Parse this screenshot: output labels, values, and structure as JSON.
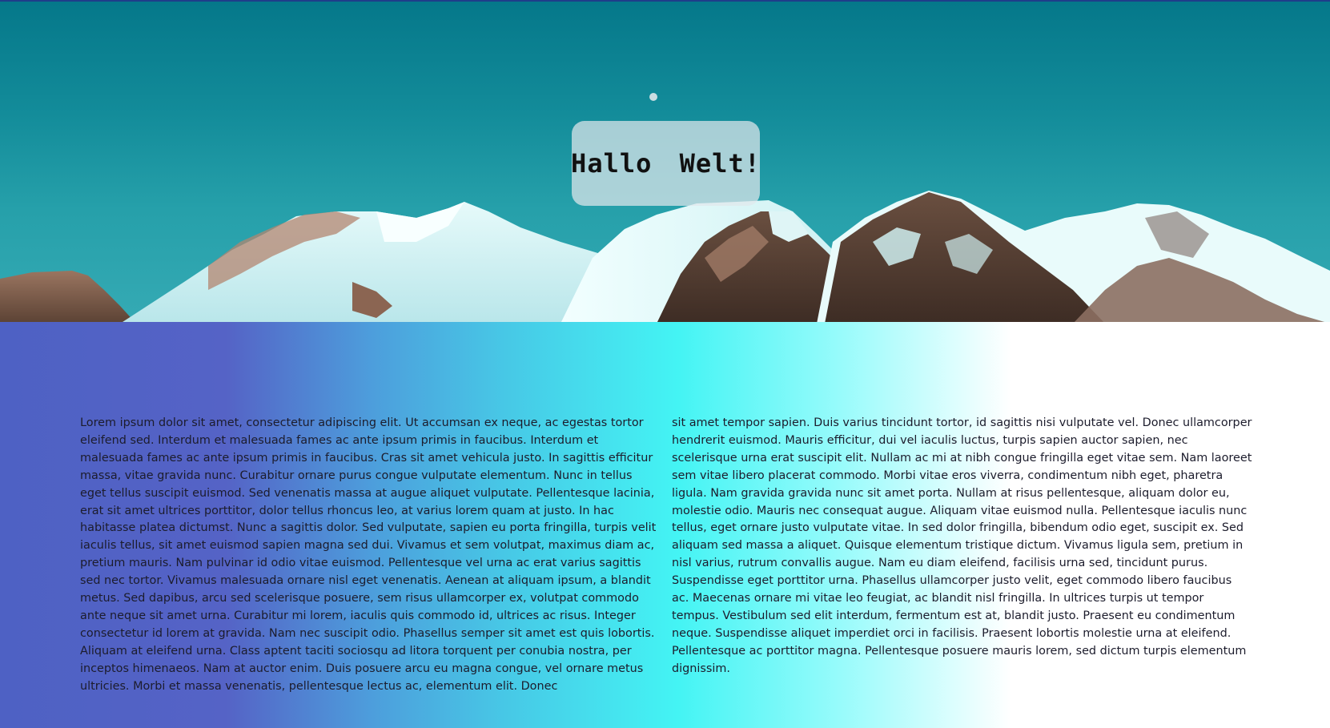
{
  "hero": {
    "title": "Hallo Welt!"
  },
  "content": {
    "column_left": "Lorem ipsum dolor sit amet, consectetur adipiscing elit. Ut accumsan ex neque, ac egestas tortor eleifend sed. Interdum et malesuada fames ac ante ipsum primis in faucibus. Interdum et malesuada fames ac ante ipsum primis in faucibus. Cras sit amet vehicula justo. In sagittis efficitur massa, vitae gravida nunc. Curabitur ornare purus congue vulputate elementum. Nunc in tellus eget tellus suscipit euismod. Sed venenatis massa at augue aliquet vulputate. Pellentesque lacinia, erat sit amet ultrices porttitor, dolor tellus rhoncus leo, at varius lorem quam at justo. In hac habitasse platea dictumst. Nunc a sagittis dolor. Sed vulputate, sapien eu porta fringilla, turpis velit iaculis tellus, sit amet euismod sapien magna sed dui. Vivamus et sem volutpat, maximus diam ac, pretium mauris. Nam pulvinar id odio vitae euismod. Pellentesque vel urna ac erat varius sagittis sed nec tortor. Vivamus malesuada ornare nisl eget venenatis. Aenean at aliquam ipsum, a blandit metus. Sed dapibus, arcu sed scelerisque posuere, sem risus ullamcorper ex, volutpat commodo ante neque sit amet urna. Curabitur mi lorem, iaculis quis commodo id, ultrices ac risus. Integer consectetur id lorem at gravida. Nam nec suscipit odio. Phasellus semper sit amet est quis lobortis. Aliquam at eleifend urna. Class aptent taciti sociosqu ad litora torquent per conubia nostra, per inceptos himenaeos. Nam at auctor enim. Duis posuere arcu eu magna congue, vel ornare metus ultricies. Morbi et massa venenatis, pellentesque lectus ac, elementum elit. Donec",
    "column_right": "sit amet tempor sapien. Duis varius tincidunt tortor, id sagittis nisi vulputate vel. Donec ullamcorper hendrerit euismod. Mauris efficitur, dui vel iaculis luctus, turpis sapien auctor sapien, nec scelerisque urna erat suscipit elit. Nullam ac mi at nibh congue fringilla eget vitae sem. Nam laoreet sem vitae libero placerat commodo. Morbi vitae eros viverra, condimentum nibh eget, pharetra ligula. Nam gravida gravida nunc sit amet porta. Nullam at risus pellentesque, aliquam dolor eu, molestie odio. Mauris nec consequat augue. Aliquam vitae euismod nulla. Pellentesque iaculis nunc tellus, eget ornare justo vulputate vitae. In sed dolor fringilla, bibendum odio eget, suscipit ex. Sed aliquam sed massa a aliquet. Quisque elementum tristique dictum. Vivamus ligula sem, pretium in nisl varius, rutrum convallis augue. Nam eu diam eleifend, facilisis urna sed, tincidunt purus. Suspendisse eget porttitor urna. Phasellus ullamcorper justo velit, eget commodo libero faucibus ac. Maecenas ornare mi vitae leo feugiat, ac blandit nisl fringilla. In ultrices turpis ut tempor tempus. Vestibulum sed elit interdum, fermentum est at, blandit justo. Praesent eu condimentum neque. Suspendisse aliquet imperdiet orci in facilisis. Praesent lobortis molestie urna at eleifend. Pellentesque ac porttitor magna. Pellentesque posuere mauris lorem, sed dictum turpis elementum dignissim."
  },
  "colors": {
    "sky": "#0a7d8e",
    "gradient": [
      "#4e61c4",
      "#4d9edc",
      "#44f4f4",
      "#96fbfb",
      "#ffffff"
    ],
    "title_box": "#e1e8ec",
    "text": "#1c1c2c"
  }
}
